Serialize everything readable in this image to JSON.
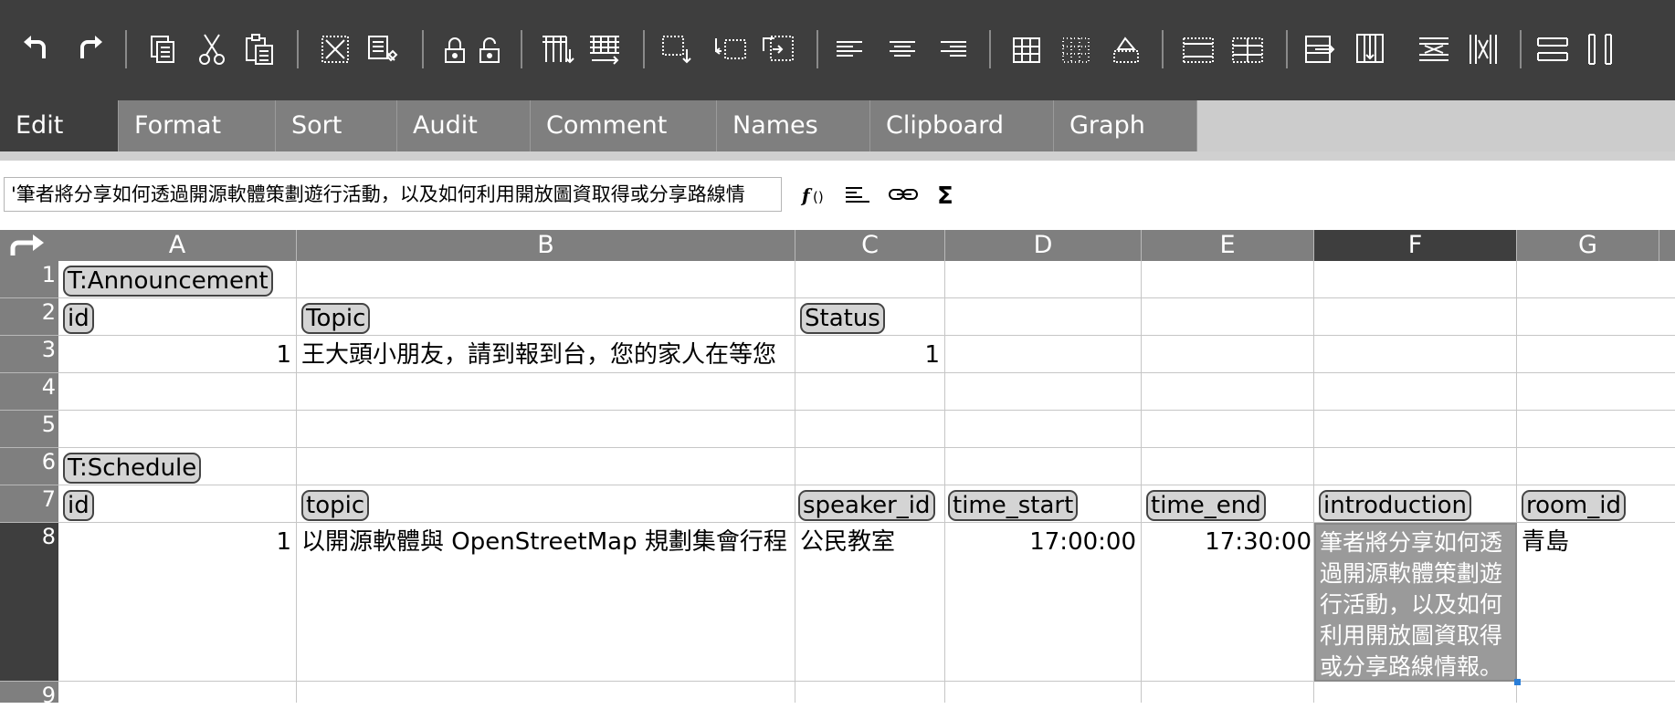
{
  "toolbar": {
    "buttons": [
      "undo-icon",
      "redo-icon",
      "copy-icon",
      "cut-icon",
      "paste-icon",
      "delete-contents-icon",
      "paste-formats-icon",
      "lock-icon",
      "unlock-icon",
      "insert-row-icon",
      "insert-column-icon",
      "delete-row-icon",
      "delete-column-icon",
      "move-icon",
      "align-left-icon",
      "align-center-icon",
      "align-right-icon",
      "borders-icon",
      "no-borders-icon",
      "fill-icon",
      "merge-cells-icon",
      "unmerge-cells-icon",
      "swap-rows-icon",
      "swap-columns-icon",
      "hide-row-icon",
      "hide-column-icon",
      "show-rows-icon",
      "show-columns-icon"
    ]
  },
  "tabs": [
    "Edit",
    "Format",
    "Sort",
    "Audit",
    "Comment",
    "Names",
    "Clipboard",
    "Graph"
  ],
  "active_tab": "Edit",
  "formula_bar": {
    "value": "'筆者將分享如何透過開源軟體策劃遊行活動，以及如何利用開放圖資取得或分享路線情",
    "icons": [
      "function-icon",
      "multiline-icon",
      "link-icon",
      "sum-icon"
    ]
  },
  "columns": [
    "A",
    "B",
    "C",
    "D",
    "E",
    "F",
    "G"
  ],
  "selected_column": "F",
  "selected_row": "8",
  "rows": [
    "1",
    "2",
    "3",
    "4",
    "5",
    "6",
    "7",
    "8",
    "9"
  ],
  "cells": {
    "A1": "T:Announcement",
    "A2": "id",
    "B2": "Topic",
    "C2": "Status",
    "A3": "1",
    "B3": "王大頭小朋友，請到報到台，您的家人在等您",
    "C3": "1",
    "A6": "T:Schedule",
    "A7": "id",
    "B7": "topic",
    "C7": "speaker_id",
    "D7": "time_start",
    "E7": "time_end",
    "F7": "introduction",
    "G7": "room_id",
    "A8": "1",
    "B8": "以開源軟體與 OpenStreetMap 規劃集會行程",
    "C8": "公民教室",
    "D8": "17:00:00",
    "E8": "17:30:00",
    "F8": "筆者將分享如何透過開源軟體策劃遊行活動，以及如何利用開放圖資取得或分享路線情報。",
    "G8": "青島"
  },
  "colors": {
    "toolbar_bg": "#3e3e3e",
    "tab_bg": "#7f7f7f",
    "selected_cell_bg": "#9a9a9a",
    "selection_handle": "#2a7ed8"
  }
}
